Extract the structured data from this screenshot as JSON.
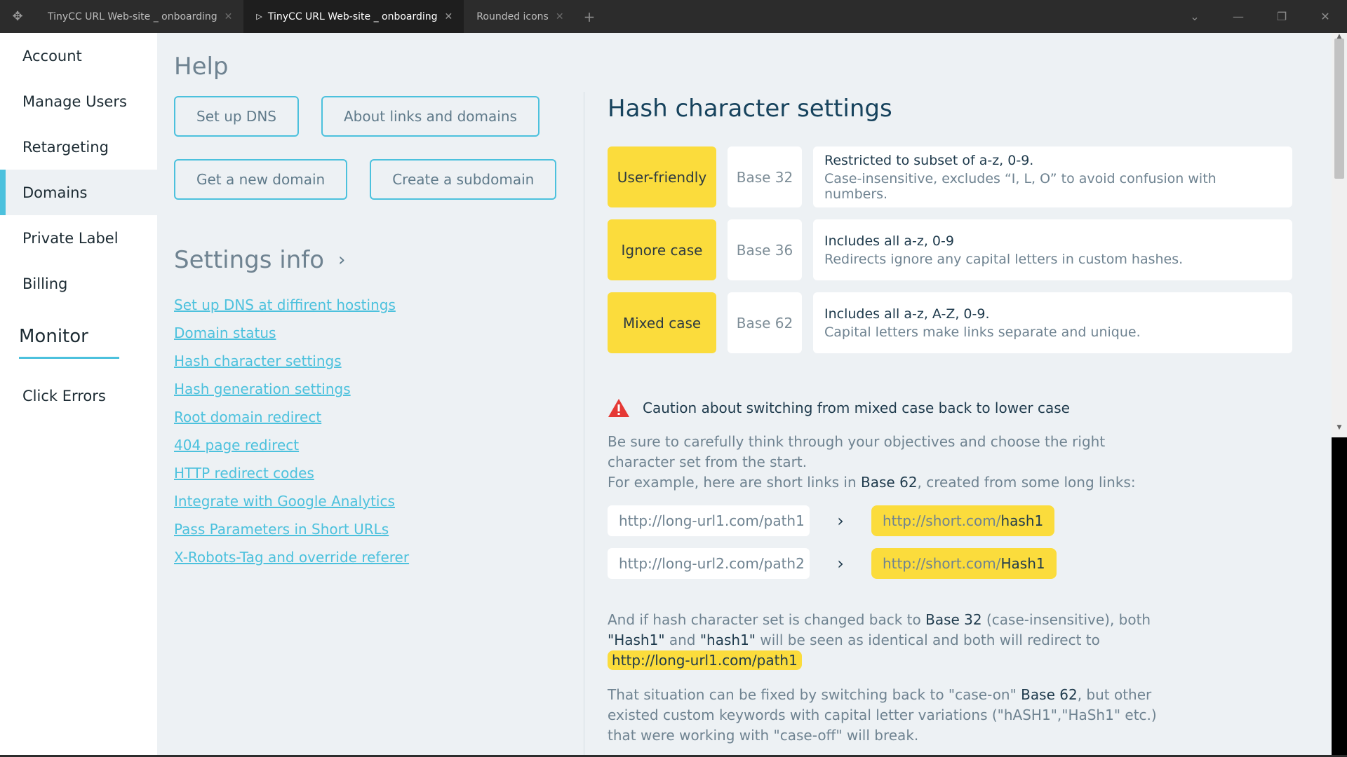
{
  "titlebar": {
    "tabs": [
      {
        "label": "TinyCC URL Web-site _ onboarding",
        "active": false
      },
      {
        "label": "TinyCC URL Web-site _ onboarding",
        "active": true
      },
      {
        "label": "Rounded icons",
        "active": false
      }
    ],
    "add_tab": "+"
  },
  "sidebar": {
    "items": [
      {
        "label": "Account"
      },
      {
        "label": "Manage Users"
      },
      {
        "label": "Retargeting"
      },
      {
        "label": "Domains",
        "active": true
      },
      {
        "label": "Private Label"
      },
      {
        "label": "Billing"
      }
    ],
    "section_title": "Monitor",
    "section_items": [
      {
        "label": "Click Errors"
      }
    ]
  },
  "help": {
    "title": "Help",
    "buttons_row1": [
      "Set up DNS",
      "About links and domains"
    ],
    "buttons_row2": [
      "Get a new domain",
      "Create a subdomain"
    ],
    "settings_title": "Settings info",
    "links": [
      "Set up DNS at diffirent hostings",
      "Domain status",
      "Hash character settings",
      "Hash generation settings",
      "Root domain redirect",
      "404 page redirect",
      "HTTP redirect codes",
      "Integrate with Google Analytics",
      "Pass Parameters in Short URLs",
      "X-Robots-Tag and override referer"
    ]
  },
  "content": {
    "title": "Hash character settings",
    "rows": [
      {
        "mode": "User-friendly",
        "base": "Base 32",
        "line1": "Restricted to subset of a-z, 0-9.",
        "line2": "Case-insensitive, excludes “I, L, O” to avoid confusion with numbers."
      },
      {
        "mode": "Ignore case",
        "base": "Base 36",
        "line1": "Includes all a-z, 0-9",
        "line2": "Redirects ignore any capital letters in custom hashes."
      },
      {
        "mode": "Mixed case",
        "base": "Base 62",
        "line1": "Includes all a-z, A-Z, 0-9.",
        "line2": "Capital letters make links separate and unique."
      }
    ],
    "caution": "Caution about switching from mixed case back to lower case",
    "p1_line1": "Be sure to carefully think through your objectives and choose the right character set from the start.",
    "p1_line2_pre": "For example, here are short links in ",
    "p1_line2_base": "Base 62",
    "p1_line2_post": ", created from some long links:",
    "examples": [
      {
        "long": "http://long-url1.com/path1",
        "short_prefix": "http://short.com/",
        "short_hash": "hash1"
      },
      {
        "long": "http://long-url2.com/path2",
        "short_prefix": "http://short.com/",
        "short_hash": "Hash1"
      }
    ],
    "p2_a": "And if hash character set is changed back to ",
    "p2_base": "Base 32",
    "p2_b": " (case-insensitive), both ",
    "p2_h1": "\"Hash1\"",
    "p2_c": " and ",
    "p2_h2": "\"hash1\"",
    "p2_d": " will be seen as identical and both will redirect to ",
    "p2_url": "http://long-url1.com/path1",
    "p3_a": "That situation can be fixed by switching back to \"case-on\" ",
    "p3_base": "Base 62",
    "p3_b": ", but other existed custom keywords with capital letter variations (\"hASH1\",\"HaSh1\" etc.) that were working with \"case-off\" will break."
  },
  "colors": {
    "accent": "#4cc1dd",
    "highlight": "#fbdc3c",
    "warning": "#e53935"
  }
}
